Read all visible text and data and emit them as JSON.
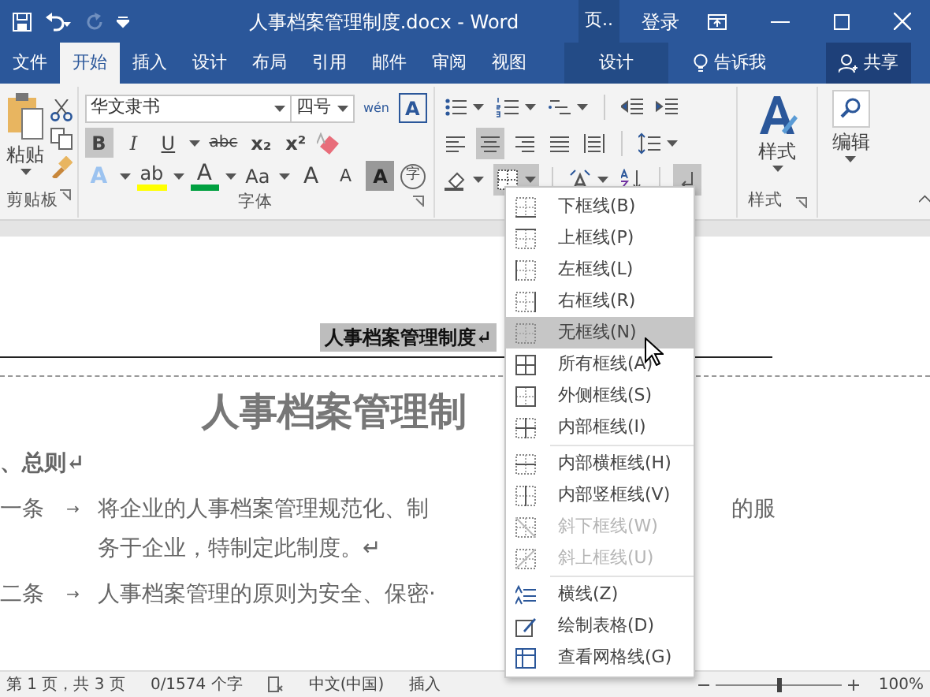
{
  "title_bar": {
    "title": "人事档案管理制度.docx - Word",
    "context_label": "页..",
    "sign_in": "登录",
    "redo_disabled": true
  },
  "tabs": [
    {
      "label": "文件",
      "selected": false,
      "kind": "normal"
    },
    {
      "label": "开始",
      "selected": true,
      "kind": "normal"
    },
    {
      "label": "插入",
      "selected": false,
      "kind": "normal"
    },
    {
      "label": "设计",
      "selected": false,
      "kind": "normal"
    },
    {
      "label": "布局",
      "selected": false,
      "kind": "normal"
    },
    {
      "label": "引用",
      "selected": false,
      "kind": "normal"
    },
    {
      "label": "邮件",
      "selected": false,
      "kind": "normal"
    },
    {
      "label": "审阅",
      "selected": false,
      "kind": "normal"
    },
    {
      "label": "视图",
      "selected": false,
      "kind": "normal"
    },
    {
      "label": "设计",
      "selected": false,
      "kind": "contextual"
    }
  ],
  "tell_me": "告诉我",
  "share": "共享",
  "clipboard": {
    "paste": "粘贴",
    "label": "剪贴板"
  },
  "font": {
    "name": "华文隶书",
    "size": "四号",
    "label": "字体",
    "row1": [
      {
        "kind": "phonetic",
        "label": "wén"
      },
      {
        "kind": "boxed",
        "label": "A"
      }
    ],
    "row2": [
      {
        "kind": "bold",
        "label": "B",
        "pressed": true
      },
      {
        "kind": "italic",
        "label": "I",
        "pressed": false
      },
      {
        "kind": "underline",
        "label": "U",
        "pressed": false
      },
      {
        "kind": "strike",
        "label": "abc",
        "pressed": false
      },
      {
        "kind": "sub",
        "label": "x₂",
        "pressed": false
      },
      {
        "kind": "sup",
        "label": "x²",
        "pressed": false
      }
    ],
    "row3": [
      {
        "kind": "effects",
        "label": "A"
      },
      {
        "kind": "highlight",
        "label": "ab",
        "color": "#ffff00"
      },
      {
        "kind": "fontcolor",
        "label": "A",
        "color": "#00a040"
      },
      {
        "kind": "case",
        "label": "Aa"
      },
      {
        "kind": "grow",
        "label": "A"
      },
      {
        "kind": "shrink",
        "label": "A"
      },
      {
        "kind": "shade",
        "label": "A"
      },
      {
        "kind": "enclose",
        "label": "字"
      }
    ]
  },
  "paragraph": {
    "rows": [
      [
        {
          "kind": "bullets",
          "pressed": false
        },
        {
          "kind": "numbering",
          "pressed": false
        },
        {
          "kind": "multilevel",
          "pressed": false
        },
        {
          "kind": "outdent",
          "pressed": false
        },
        {
          "kind": "indent",
          "pressed": false
        }
      ],
      [
        {
          "kind": "align-left",
          "pressed": false
        },
        {
          "kind": "align-center",
          "pressed": true
        },
        {
          "kind": "align-right",
          "pressed": false
        },
        {
          "kind": "justify",
          "pressed": false
        },
        {
          "kind": "distribute",
          "pressed": false
        },
        {
          "kind": "spacing",
          "pressed": false
        }
      ],
      [
        {
          "kind": "shading",
          "pressed": false
        },
        {
          "kind": "borders",
          "pressed": true
        },
        {
          "kind": "asian",
          "pressed": false
        },
        {
          "kind": "sort",
          "pressed": false
        },
        {
          "kind": "marks",
          "pressed": true
        }
      ]
    ]
  },
  "styles": {
    "button": "样式",
    "label": "样式"
  },
  "editing": {
    "button": "编辑"
  },
  "border_menu": {
    "sections": [
      [
        {
          "label": "下框线(B)",
          "kind": "bottom",
          "selected": false,
          "disabled": false
        },
        {
          "label": "上框线(P)",
          "kind": "top",
          "selected": false,
          "disabled": false
        },
        {
          "label": "左框线(L)",
          "kind": "left",
          "selected": false,
          "disabled": false
        },
        {
          "label": "右框线(R)",
          "kind": "right",
          "selected": false,
          "disabled": false
        },
        {
          "label": "无框线(N)",
          "kind": "none",
          "selected": true,
          "disabled": false
        },
        {
          "label": "所有框线(A)",
          "kind": "all",
          "selected": false,
          "disabled": false
        },
        {
          "label": "外侧框线(S)",
          "kind": "outside",
          "selected": false,
          "disabled": false
        },
        {
          "label": "内部框线(I)",
          "kind": "inside",
          "selected": false,
          "disabled": false
        }
      ],
      [
        {
          "label": "内部横框线(H)",
          "kind": "inside-h",
          "selected": false,
          "disabled": false
        },
        {
          "label": "内部竖框线(V)",
          "kind": "inside-v",
          "selected": false,
          "disabled": false
        },
        {
          "label": "斜下框线(W)",
          "kind": "diag-down",
          "selected": false,
          "disabled": true
        },
        {
          "label": "斜上框线(U)",
          "kind": "diag-up",
          "selected": false,
          "disabled": true
        }
      ],
      [
        {
          "label": "横线(Z)",
          "kind": "hline",
          "selected": false,
          "disabled": false
        },
        {
          "label": "绘制表格(D)",
          "kind": "draw",
          "selected": false,
          "disabled": false
        },
        {
          "label": "查看网格线(G)",
          "kind": "grid",
          "selected": false,
          "disabled": false
        }
      ]
    ]
  },
  "document": {
    "header": "人事档案管理制度↵",
    "title": "人事档案管理制",
    "heading": "、总则↵",
    "articles": [
      {
        "number": "一条",
        "tab": "→",
        "text": "将企业的人事档案管理规范化、制",
        "right_text": "的服",
        "continuation": "务于企业，特制定此制度。↵"
      },
      {
        "number": "二条",
        "tab": "→",
        "text": "人事档案管理的原则为安全、保密·"
      }
    ]
  },
  "status_bar": {
    "page": "第 1 页，共 3 页",
    "words": "0/1574 个字",
    "language": "中文(中国)",
    "mode": "插入",
    "zoom": "100%",
    "zoom_slider": {
      "level": 0.5
    }
  }
}
